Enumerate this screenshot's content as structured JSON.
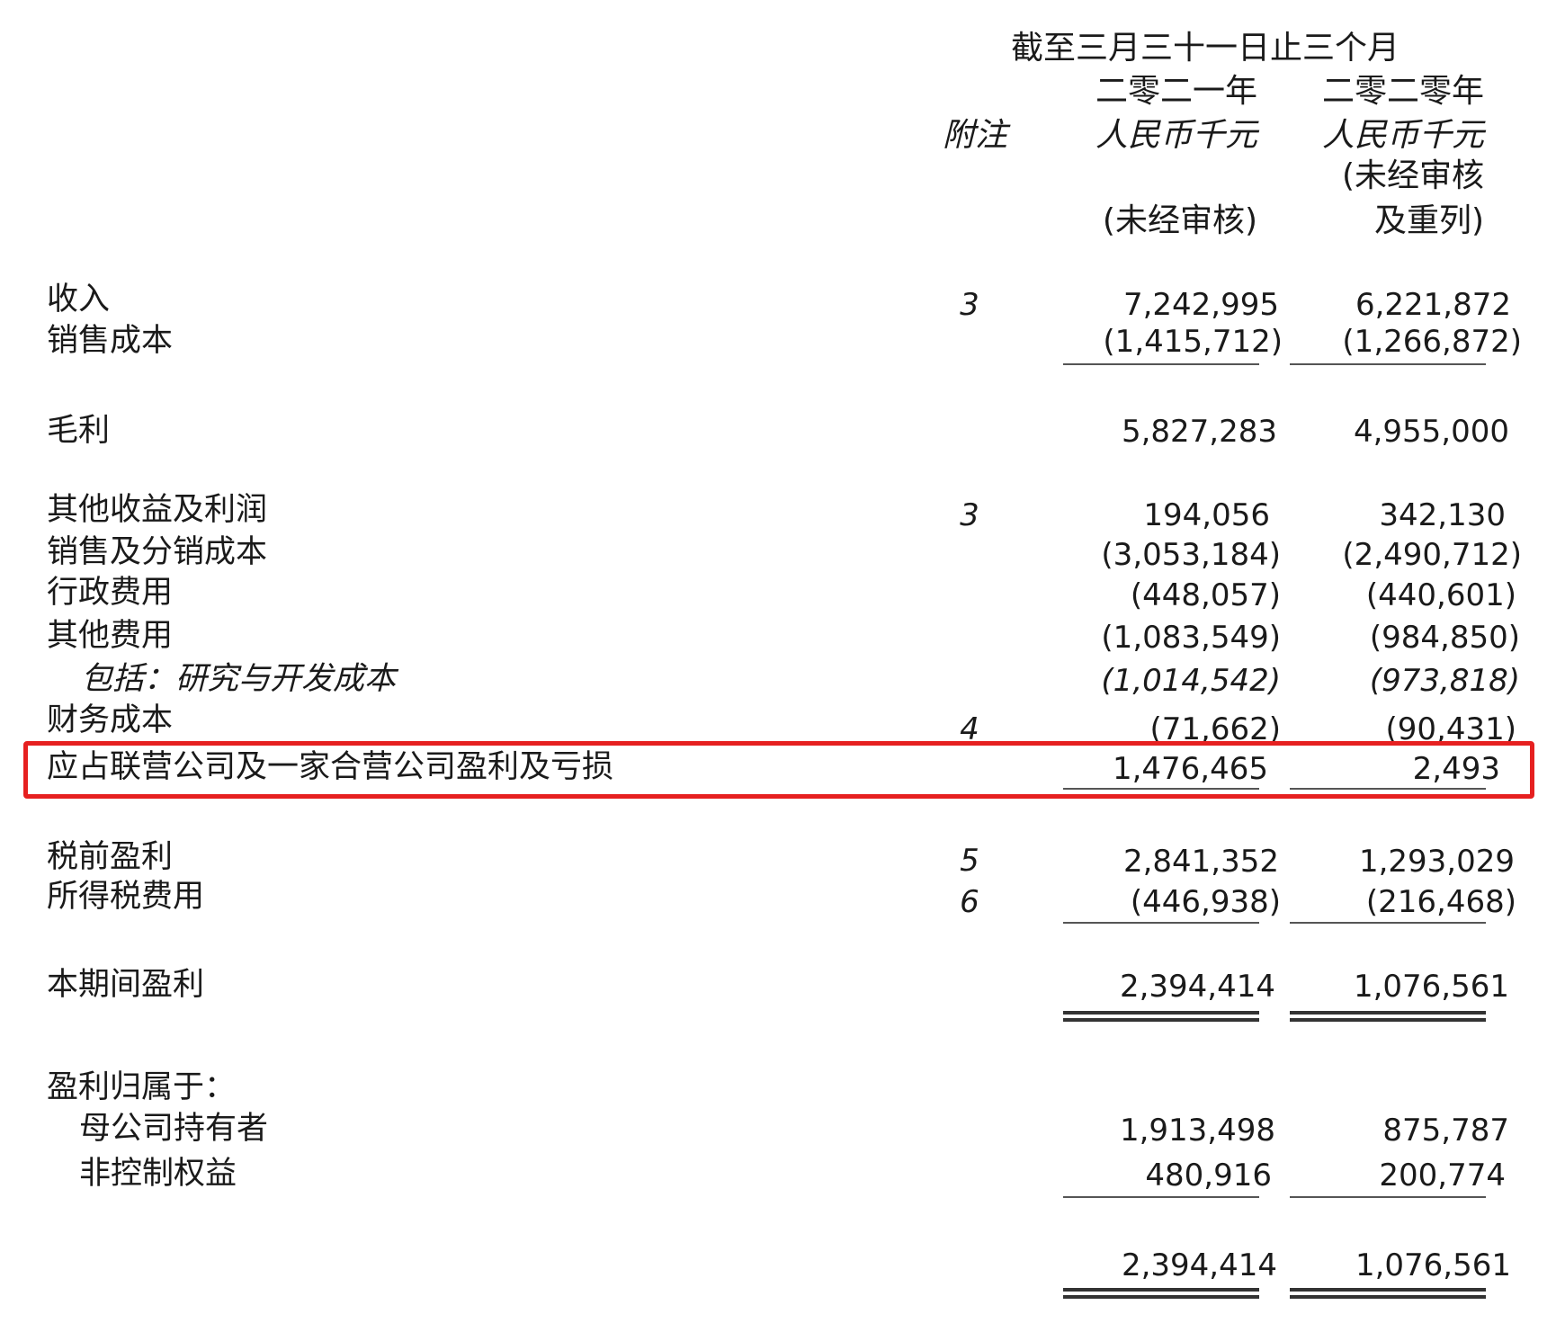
{
  "header": {
    "period": "截至三月三十一日止三个月",
    "note_label": "附注",
    "col1": {
      "year": "二零二一年",
      "currency": "人民币千元",
      "status": "(未经审核)"
    },
    "col2": {
      "year": "二零二零年",
      "currency": "人民币千元",
      "status_line1": "(未经审核",
      "status_line2": "及重列)"
    }
  },
  "rows": [
    {
      "label": "收入",
      "note": "3",
      "v2021": "7,242,995",
      "v2020": "6,221,872"
    },
    {
      "label": "销售成本",
      "note": "",
      "v2021": "(1,415,712)",
      "v2020": "(1,266,872)"
    },
    {
      "label": "毛利",
      "note": "",
      "v2021": "5,827,283",
      "v2020": "4,955,000"
    },
    {
      "label": "其他收益及利润",
      "note": "3",
      "v2021": "194,056",
      "v2020": "342,130"
    },
    {
      "label": "销售及分销成本",
      "note": "",
      "v2021": "(3,053,184)",
      "v2020": "(2,490,712)"
    },
    {
      "label": "行政费用",
      "note": "",
      "v2021": "(448,057)",
      "v2020": "(440,601)"
    },
    {
      "label": "其他费用",
      "note": "",
      "v2021": "(1,083,549)",
      "v2020": "(984,850)"
    },
    {
      "label": "包括：研究与开发成本",
      "note": "",
      "v2021": "(1,014,542)",
      "v2020": "(973,818)"
    },
    {
      "label": "财务成本",
      "note": "4",
      "v2021": "(71,662)",
      "v2020": "(90,431)"
    },
    {
      "label": "应占联营公司及一家合营公司盈利及亏损",
      "note": "",
      "v2021": "1,476,465",
      "v2020": "2,493"
    },
    {
      "label": "税前盈利",
      "note": "5",
      "v2021": "2,841,352",
      "v2020": "1,293,029"
    },
    {
      "label": "所得税费用",
      "note": "6",
      "v2021": "(446,938)",
      "v2020": "(216,468)"
    },
    {
      "label": "本期间盈利",
      "note": "",
      "v2021": "2,394,414",
      "v2020": "1,076,561"
    },
    {
      "label": "盈利归属于：",
      "note": "",
      "v2021": "",
      "v2020": ""
    },
    {
      "label": "母公司持有者",
      "note": "",
      "v2021": "1,913,498",
      "v2020": "875,787"
    },
    {
      "label": "非控制权益",
      "note": "",
      "v2021": "480,916",
      "v2020": "200,774"
    },
    {
      "label": "",
      "note": "",
      "v2021": "2,394,414",
      "v2020": "1,076,561"
    }
  ],
  "highlight_color": "#e62020"
}
